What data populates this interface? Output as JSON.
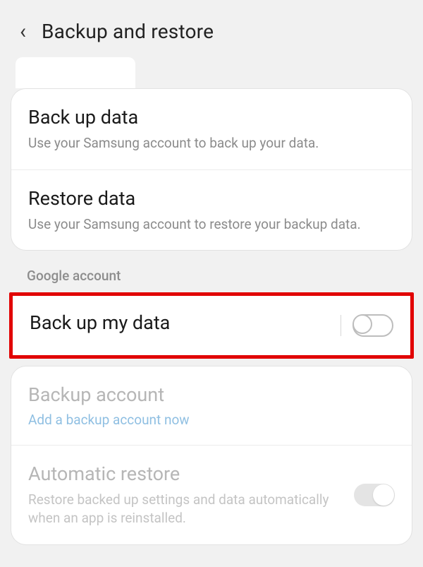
{
  "header": {
    "title": "Backup and restore"
  },
  "samsung": {
    "backup": {
      "label": "Back up data",
      "sub": "Use your Samsung account to back up your data."
    },
    "restore": {
      "label": "Restore data",
      "sub": "Use your Samsung account to restore your backup data."
    }
  },
  "google": {
    "section": "Google account",
    "backup_my_data": {
      "label": "Back up my data"
    },
    "backup_account": {
      "label": "Backup account",
      "link": "Add a backup account now"
    },
    "auto_restore": {
      "label": "Automatic restore",
      "sub": "Restore backed up settings and data automatically when an app is reinstalled."
    }
  }
}
